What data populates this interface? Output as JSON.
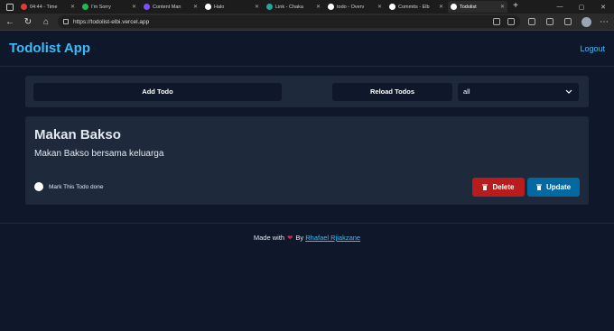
{
  "browser": {
    "tabs": [
      {
        "title": "04:44 - Time",
        "fav_color": "#e53935"
      },
      {
        "title": "I'm Sorry",
        "fav_color": "#1db954"
      },
      {
        "title": "Content Man",
        "fav_color": "#7c4dff"
      },
      {
        "title": "Halo",
        "fav_color": "#ffffff"
      },
      {
        "title": "Link - Chaka",
        "fav_color": "#26a69a"
      },
      {
        "title": "todo - Overv",
        "fav_color": "#ffffff"
      },
      {
        "title": "Commits - Elb",
        "fav_color": "#ffffff"
      },
      {
        "title": "Todolist",
        "fav_color": "#ffffff"
      }
    ],
    "url": "https://todolist-elbi.vercel.app"
  },
  "app": {
    "title": "Todolist App",
    "logout_label": "Logout"
  },
  "toolbar": {
    "add_label": "Add Todo",
    "reload_label": "Reload Todos",
    "filter_value": "all"
  },
  "todo": {
    "title": "Makan Bakso",
    "description": "Makan Bakso bersama keluarga",
    "done_label": "Mark This Todo done",
    "delete_label": "Delete",
    "update_label": "Update"
  },
  "footer": {
    "made_with": "Made with",
    "by": "By",
    "author": "Rhafael Rjiakzane"
  },
  "colors": {
    "accent": "#38bdf8",
    "delete": "#b91c1c",
    "update": "#0369a1",
    "background": "#0f172a",
    "card": "#1e293b"
  }
}
